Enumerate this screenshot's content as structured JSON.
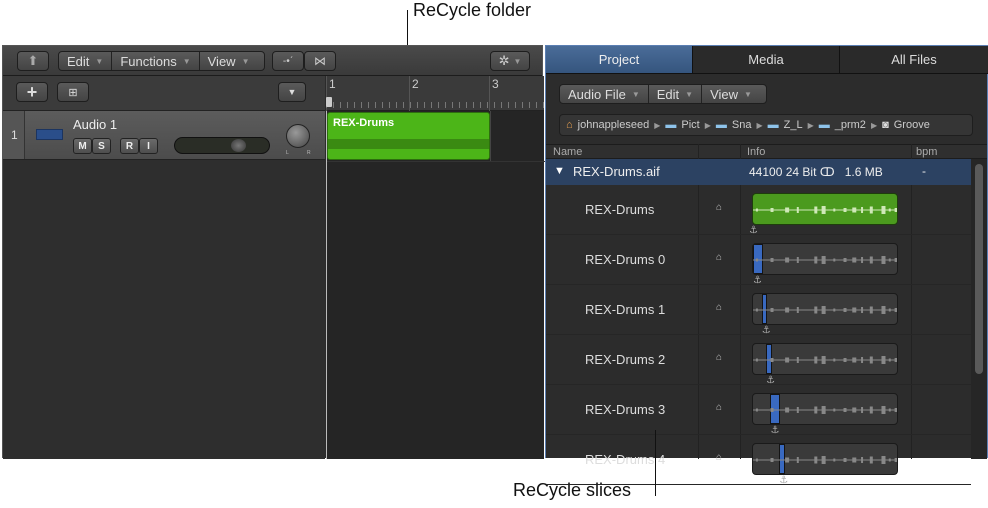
{
  "callouts": {
    "folder": "ReCycle folder",
    "slices": "ReCycle slices"
  },
  "left": {
    "toolbar": {
      "edit": "Edit",
      "functions": "Functions",
      "view": "View"
    },
    "ruler": [
      "1",
      "2",
      "3"
    ],
    "track": {
      "number": "1",
      "name": "Audio 1",
      "m": "M",
      "s": "S",
      "r": "R",
      "i": "I",
      "pan_l": "L",
      "pan_r": "R",
      "volume": 0.72
    },
    "region": {
      "name": "REX-Drums",
      "color": "#4caf1a"
    }
  },
  "right": {
    "tabs": [
      "Project",
      "Media",
      "All Files"
    ],
    "menus": {
      "audio_file": "Audio File",
      "edit": "Edit",
      "view": "View"
    },
    "path": [
      "johnappleseed",
      "Pict",
      "Sna",
      "Z_L",
      "_prm2",
      "Groove"
    ],
    "columns": {
      "name": "Name",
      "info": "Info",
      "bpm": "bpm"
    },
    "file": {
      "name": "REX-Drums.aif",
      "rate": "44100",
      "bits": "24 Bit",
      "size": "1.6 MB",
      "bpm": "-"
    },
    "slices": [
      {
        "name": "REX-Drums",
        "full": true,
        "start": 0,
        "end": 1
      },
      {
        "name": "REX-Drums 0",
        "start": 0.0,
        "end": 0.07
      },
      {
        "name": "REX-Drums 1",
        "start": 0.06,
        "end": 0.1
      },
      {
        "name": "REX-Drums 2",
        "start": 0.09,
        "end": 0.13
      },
      {
        "name": "REX-Drums 3",
        "start": 0.12,
        "end": 0.19
      },
      {
        "name": "REX-Drums 4",
        "start": 0.18,
        "end": 0.22
      }
    ],
    "highlight_color": "#3a6fd0"
  }
}
